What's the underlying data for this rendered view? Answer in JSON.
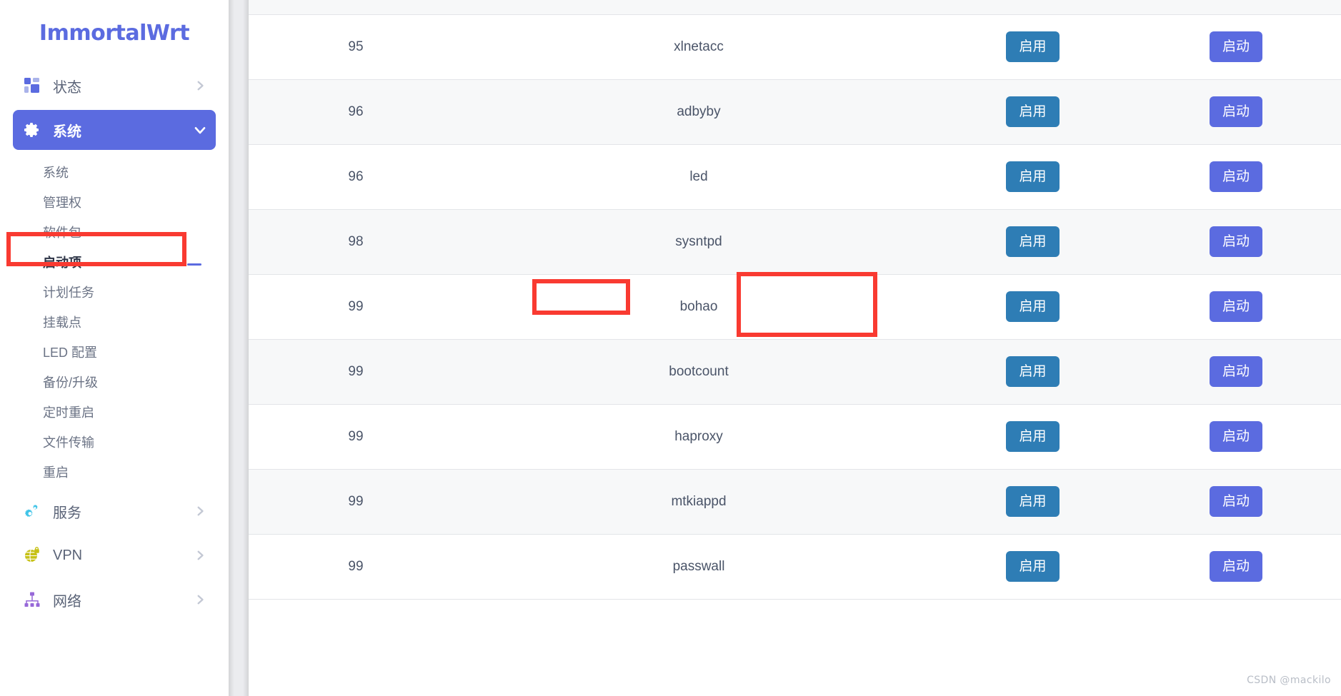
{
  "brand": {
    "name": "ImmortalWrt"
  },
  "sidebar": {
    "groups": [
      {
        "label": "状态",
        "icon": "grid-icon",
        "caret": "chevron-right-icon",
        "active": false,
        "children": []
      },
      {
        "label": "系统",
        "icon": "gear-icon",
        "caret": "chevron-down-icon",
        "active": true,
        "children": [
          {
            "label": "系统",
            "selected": false
          },
          {
            "label": "管理权",
            "selected": false
          },
          {
            "label": "软件包",
            "selected": false
          },
          {
            "label": "启动项",
            "selected": true
          },
          {
            "label": "计划任务",
            "selected": false
          },
          {
            "label": "挂载点",
            "selected": false
          },
          {
            "label": "LED 配置",
            "selected": false
          },
          {
            "label": "备份/升级",
            "selected": false
          },
          {
            "label": "定时重启",
            "selected": false
          },
          {
            "label": "文件传输",
            "selected": false
          },
          {
            "label": "重启",
            "selected": false
          }
        ]
      },
      {
        "label": "服务",
        "icon": "gears-icon",
        "caret": "chevron-right-icon",
        "active": false,
        "children": []
      },
      {
        "label": "VPN",
        "icon": "globe-lock-icon",
        "caret": "chevron-right-icon",
        "active": false,
        "children": []
      },
      {
        "label": "网络",
        "icon": "network-icon",
        "caret": "chevron-right-icon",
        "active": false,
        "children": []
      }
    ]
  },
  "table": {
    "enable_label": "启用",
    "start_label": "启动",
    "rows": [
      {
        "order": "95",
        "name": "xlnetacc",
        "enable": "启用",
        "start": "启动"
      },
      {
        "order": "96",
        "name": "adbyby",
        "enable": "启用",
        "start": "启动"
      },
      {
        "order": "96",
        "name": "led",
        "enable": "启用",
        "start": "启动"
      },
      {
        "order": "98",
        "name": "sysntpd",
        "enable": "启用",
        "start": "启动"
      },
      {
        "order": "99",
        "name": "bohao",
        "enable": "启用",
        "start": "启动"
      },
      {
        "order": "99",
        "name": "bootcount",
        "enable": "启用",
        "start": "启动"
      },
      {
        "order": "99",
        "name": "haproxy",
        "enable": "启用",
        "start": "启动"
      },
      {
        "order": "99",
        "name": "mtkiappd",
        "enable": "启用",
        "start": "启动"
      },
      {
        "order": "99",
        "name": "passwall",
        "enable": "启用",
        "start": "启动"
      }
    ]
  },
  "annotations": {
    "color": "#f93a31",
    "boxes": [
      {
        "name": "sidebar-startup-highlight",
        "target": "启动项"
      },
      {
        "name": "service-name-highlight",
        "target": "bohao"
      },
      {
        "name": "enable-button-highlight",
        "target": "启用"
      }
    ]
  },
  "watermark": {
    "text": "CSDN @mackilo"
  },
  "colors": {
    "brand": "#5b6be0",
    "enable_button": "#2e7db5",
    "start_button": "#5b6be0",
    "annotation": "#f93a31",
    "stripe": "#f7f8f9"
  }
}
